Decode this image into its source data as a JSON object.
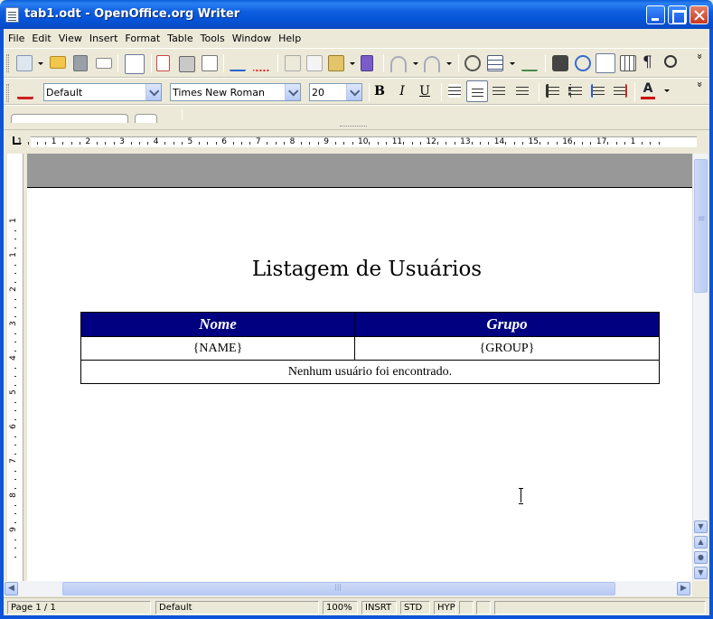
{
  "window": {
    "title": "tab1.odt - OpenOffice.org Writer"
  },
  "menu": [
    "File",
    "Edit",
    "View",
    "Insert",
    "Format",
    "Table",
    "Tools",
    "Window",
    "Help"
  ],
  "format_toolbar": {
    "style": "Default",
    "font": "Times New Roman",
    "size": "20",
    "bold": "B",
    "italic": "I",
    "underline": "U",
    "font_color_letter": "A"
  },
  "ruler": {
    "h_numbers": [
      "1",
      "1",
      "2",
      "3",
      "4",
      "5",
      "6",
      "7",
      "8",
      "9",
      "10",
      "11",
      "12",
      "13",
      "14",
      "15",
      "16",
      "17",
      "1"
    ],
    "v_numbers": [
      "1",
      "1",
      "2",
      "3",
      "4",
      "5",
      "6",
      "7",
      "8",
      "9"
    ]
  },
  "document": {
    "title": "Listagem de Usuários",
    "table": {
      "headers": [
        "Nome",
        "Grupo"
      ],
      "row": [
        "{NAME}",
        "{GROUP}"
      ],
      "empty_message": "Nenhum usuário foi encontrado."
    }
  },
  "statusbar": {
    "page": "Page 1 / 1",
    "style": "Default",
    "zoom": "100%",
    "insert_mode": "INSRT",
    "selection_mode": "STD",
    "hyphenation": "HYP"
  },
  "colors": {
    "table_header_bg": "#000080",
    "page_header_bg": "#989898"
  }
}
